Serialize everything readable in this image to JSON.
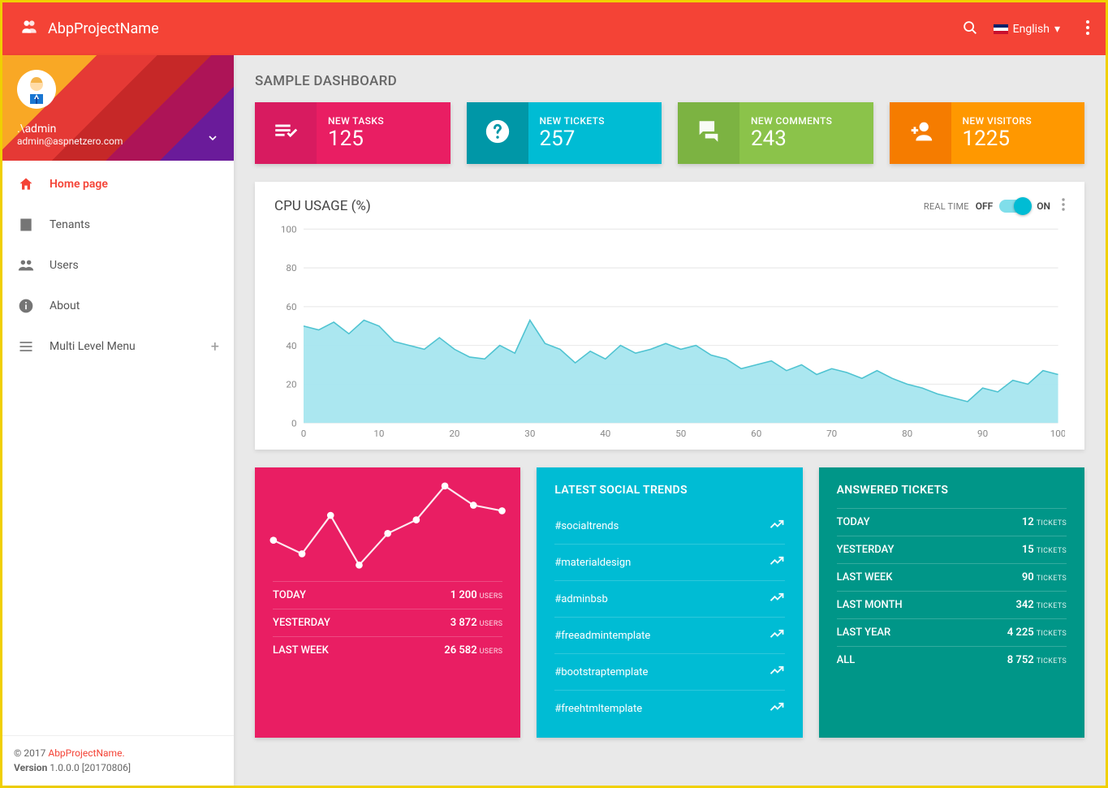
{
  "header": {
    "brand": "AbpProjectName",
    "language": "English"
  },
  "user": {
    "name": ".\\admin",
    "email": "admin@aspnetzero.com"
  },
  "sidebar": {
    "items": [
      {
        "label": "Home page"
      },
      {
        "label": "Tenants"
      },
      {
        "label": "Users"
      },
      {
        "label": "About"
      },
      {
        "label": "Multi Level Menu"
      }
    ]
  },
  "footer": {
    "copyright": "© 2017 ",
    "project": "AbpProjectName.",
    "version_label": "Version",
    "version": "1.0.0.0 [20170806]"
  },
  "page": {
    "title": "SAMPLE DASHBOARD"
  },
  "stats": [
    {
      "label": "NEW TASKS",
      "value": "125"
    },
    {
      "label": "NEW TICKETS",
      "value": "257"
    },
    {
      "label": "NEW COMMENTS",
      "value": "243"
    },
    {
      "label": "NEW VISITORS",
      "value": "1225"
    }
  ],
  "cpu": {
    "title": "CPU USAGE (%)",
    "realtime_label": "REAL TIME",
    "off": "OFF",
    "on": "ON"
  },
  "chart_data": {
    "type": "area",
    "title": "CPU USAGE (%)",
    "xlabel": "",
    "ylabel": "",
    "x_ticks": [
      0,
      10,
      20,
      30,
      40,
      50,
      60,
      70,
      80,
      90,
      100
    ],
    "y_ticks": [
      0,
      20,
      40,
      60,
      80,
      100
    ],
    "ylim": [
      0,
      100
    ],
    "series": [
      {
        "name": "cpu",
        "x": [
          0,
          2,
          4,
          6,
          8,
          10,
          12,
          14,
          16,
          18,
          20,
          22,
          24,
          26,
          28,
          30,
          32,
          34,
          36,
          38,
          40,
          42,
          44,
          46,
          48,
          50,
          52,
          54,
          56,
          58,
          60,
          62,
          64,
          66,
          68,
          70,
          72,
          74,
          76,
          78,
          80,
          82,
          84,
          86,
          88,
          90,
          92,
          94,
          96,
          98,
          100
        ],
        "values": [
          50,
          48,
          52,
          46,
          53,
          50,
          42,
          40,
          38,
          44,
          38,
          34,
          33,
          40,
          36,
          53,
          41,
          38,
          31,
          37,
          33,
          40,
          36,
          38,
          41,
          38,
          40,
          35,
          33,
          28,
          30,
          32,
          27,
          30,
          25,
          28,
          26,
          23,
          27,
          23,
          20,
          18,
          15,
          13,
          11,
          18,
          16,
          22,
          20,
          27,
          25
        ]
      }
    ]
  },
  "spark_data": {
    "type": "line",
    "values": [
      42,
      30,
      64,
      20,
      48,
      60,
      90,
      73,
      68
    ]
  },
  "user_stats": {
    "rows": [
      {
        "k": "TODAY",
        "v": "1 200",
        "unit": "USERS"
      },
      {
        "k": "YESTERDAY",
        "v": "3 872",
        "unit": "USERS"
      },
      {
        "k": "LAST WEEK",
        "v": "26 582",
        "unit": "USERS"
      }
    ]
  },
  "trends": {
    "title": "LATEST SOCIAL TRENDS",
    "items": [
      "#socialtrends",
      "#materialdesign",
      "#adminbsb",
      "#freeadmintemplate",
      "#bootstraptemplate",
      "#freehtmltemplate"
    ]
  },
  "answered": {
    "title": "ANSWERED TICKETS",
    "rows": [
      {
        "k": "TODAY",
        "v": "12",
        "unit": "TICKETS"
      },
      {
        "k": "YESTERDAY",
        "v": "15",
        "unit": "TICKETS"
      },
      {
        "k": "LAST WEEK",
        "v": "90",
        "unit": "TICKETS"
      },
      {
        "k": "LAST MONTH",
        "v": "342",
        "unit": "TICKETS"
      },
      {
        "k": "LAST YEAR",
        "v": "4 225",
        "unit": "TICKETS"
      },
      {
        "k": "ALL",
        "v": "8 752",
        "unit": "TICKETS"
      }
    ]
  }
}
